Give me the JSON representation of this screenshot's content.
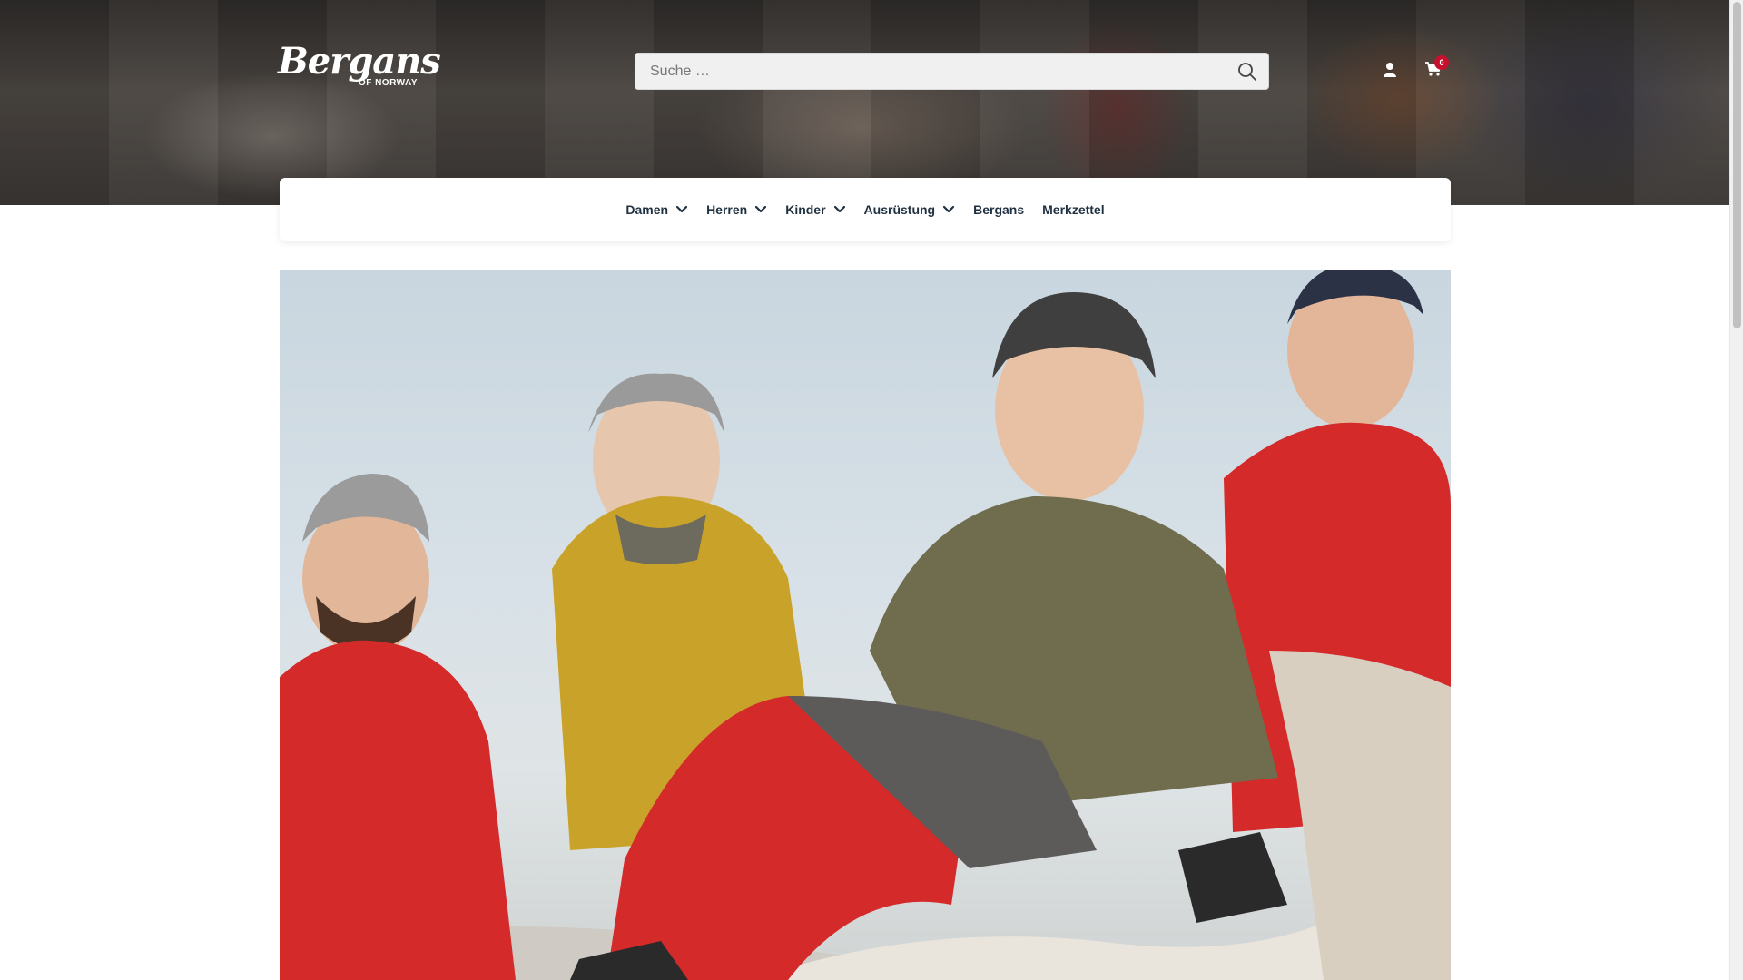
{
  "header": {
    "logo": {
      "brand": "Bergans",
      "sub": "OF NORWAY"
    },
    "search": {
      "placeholder": "Suche …"
    },
    "cart": {
      "count": "0"
    }
  },
  "nav": {
    "items": [
      {
        "label": "Damen",
        "has_dropdown": true
      },
      {
        "label": "Herren",
        "has_dropdown": true
      },
      {
        "label": "Kinder",
        "has_dropdown": true
      },
      {
        "label": "Ausrüstung",
        "has_dropdown": true
      },
      {
        "label": "Bergans",
        "has_dropdown": false
      },
      {
        "label": "Merkzettel",
        "has_dropdown": false
      }
    ]
  },
  "colors": {
    "nav_text": "#1f3040",
    "badge": "#c8102e",
    "jacket_red": "#d42a2a",
    "jacket_yellow": "#c9a22a",
    "jacket_olive": "#6f6d4e"
  },
  "icons": [
    "search-icon",
    "user-icon",
    "cart-icon",
    "chevron-down-icon"
  ]
}
